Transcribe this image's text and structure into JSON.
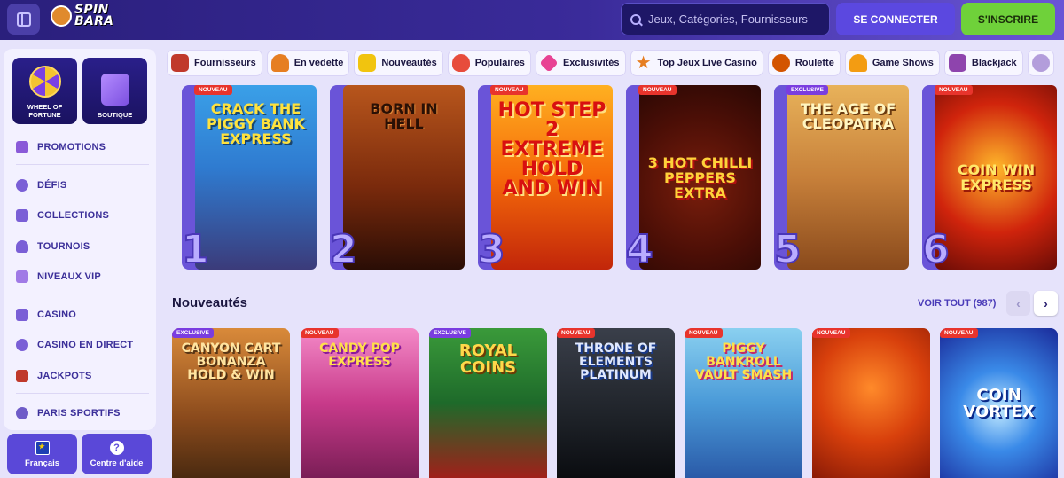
{
  "header": {
    "logo_line1": "SPIN",
    "logo_line2": "BARA",
    "search_placeholder": "Jeux, Catégories, Fournisseurs",
    "login_label": "SE CONNECTER",
    "register_label": "S'INSCRIRE"
  },
  "sidebar": {
    "tiles": [
      {
        "label": "WHEEL OF FORTUNE",
        "icon": "wheel-icon"
      },
      {
        "label": "BOUTIQUE",
        "icon": "shopping-bag-icon"
      }
    ],
    "items": [
      {
        "label": "PROMOTIONS",
        "icon": "gift-icon"
      },
      {
        "label": "DÉFIS",
        "icon": "medal-icon"
      },
      {
        "label": "COLLECTIONS",
        "icon": "cards-icon"
      },
      {
        "label": "TOURNOIS",
        "icon": "trophy-icon"
      },
      {
        "label": "NIVEAUX VIP",
        "icon": "crown-icon"
      },
      {
        "label": "CASINO",
        "icon": "casino-icon"
      },
      {
        "label": "CASINO EN DIRECT",
        "icon": "live-icon"
      },
      {
        "label": "JACKPOTS",
        "icon": "jackpot-icon"
      },
      {
        "label": "PARIS SPORTIFS",
        "icon": "football-icon"
      }
    ],
    "language_label": "Français",
    "help_label": "Centre d'aide"
  },
  "categories": [
    {
      "label": "Fournisseurs",
      "icon": "book-icon",
      "color": "#c0392b"
    },
    {
      "label": "En vedette",
      "icon": "burger-icon",
      "color": "#e67e22"
    },
    {
      "label": "Nouveautés",
      "icon": "hand-icon",
      "color": "#f1c40f"
    },
    {
      "label": "Populaires",
      "icon": "fire-icon",
      "color": "#e74c3c"
    },
    {
      "label": "Exclusivités",
      "icon": "diamond-icon",
      "color": "#e84393"
    },
    {
      "label": "Top Jeux Live Casino",
      "icon": "star-icon",
      "color": "#e67e22"
    },
    {
      "label": "Roulette",
      "icon": "roulette-icon",
      "color": "#d35400"
    },
    {
      "label": "Game Shows",
      "icon": "trophy-icon",
      "color": "#f39c12"
    },
    {
      "label": "Blackjack",
      "icon": "playing-card-icon",
      "color": "#8e44ad"
    }
  ],
  "top_games": [
    {
      "rank": "1",
      "title": "CRACK THE PIGGY BANK EXPRESS",
      "badge": "NOUVEAU"
    },
    {
      "rank": "2",
      "title": "BORN IN HELL",
      "badge": ""
    },
    {
      "rank": "3",
      "title": "HOT STEP 2 EXTREME HOLD AND WIN",
      "badge": "NOUVEAU"
    },
    {
      "rank": "4",
      "title": "3 HOT CHILLI PEPPERS EXTRA",
      "badge": "NOUVEAU"
    },
    {
      "rank": "5",
      "title": "THE AGE OF CLEOPATRA",
      "badge": "EXCLUSIVE"
    },
    {
      "rank": "6",
      "title": "COIN WIN EXPRESS",
      "badge": "NOUVEAU"
    }
  ],
  "new_section": {
    "title": "Nouveautés",
    "see_all": "VOIR TOUT (987)",
    "games": [
      {
        "title": "CANYON CART BONANZA HOLD & WIN",
        "badge": "EXCLUSIVE"
      },
      {
        "title": "CANDY POP EXPRESS",
        "badge": "NOUVEAU"
      },
      {
        "title": "ROYAL COINS",
        "badge": "EXCLUSIVE"
      },
      {
        "title": "THRONE OF ELEMENTS PLATINUM",
        "badge": "NOUVEAU"
      },
      {
        "title": "PIGGY BANKROLL VAULT SMASH",
        "badge": "NOUVEAU"
      },
      {
        "title": "",
        "badge": "NOUVEAU"
      },
      {
        "title": "COIN VORTEX",
        "badge": "NOUVEAU"
      }
    ]
  },
  "colors": {
    "header_bg": "#2a1f7c",
    "accent_purple": "#5b48e0",
    "register_green": "#6fd13a",
    "badge_red": "#e8342c"
  }
}
